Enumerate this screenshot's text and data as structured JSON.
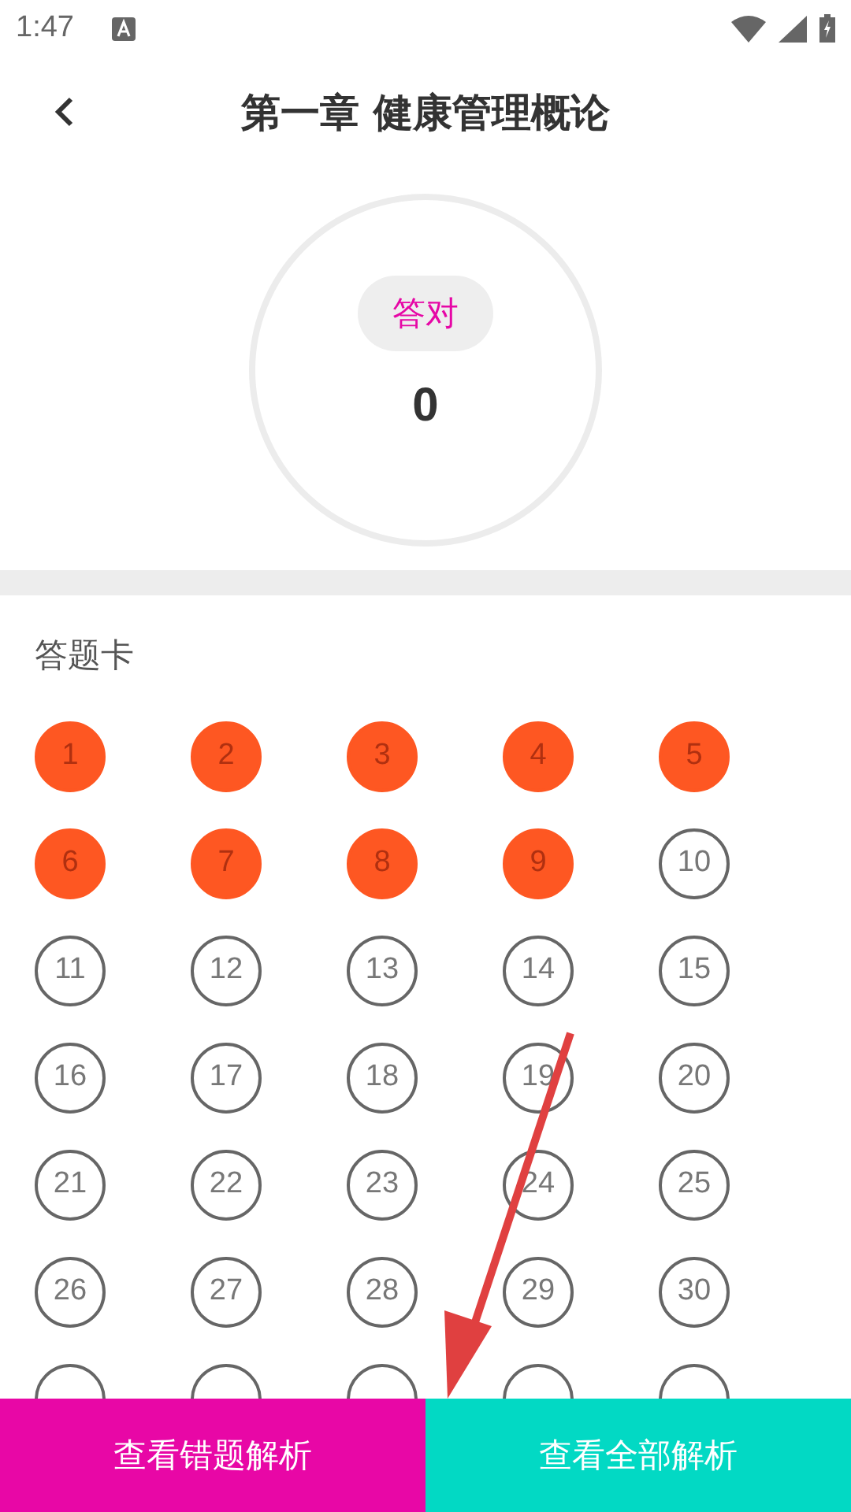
{
  "status_bar": {
    "time": "1:47"
  },
  "header": {
    "title": "第一章 健康管理概论"
  },
  "score": {
    "label": "答对",
    "value": "0"
  },
  "answer_card": {
    "title": "答题卡",
    "items": [
      {
        "label": "1",
        "answered": true
      },
      {
        "label": "2",
        "answered": true
      },
      {
        "label": "3",
        "answered": true
      },
      {
        "label": "4",
        "answered": true
      },
      {
        "label": "5",
        "answered": true
      },
      {
        "label": "6",
        "answered": true
      },
      {
        "label": "7",
        "answered": true
      },
      {
        "label": "8",
        "answered": true
      },
      {
        "label": "9",
        "answered": true
      },
      {
        "label": "10",
        "answered": false
      },
      {
        "label": "11",
        "answered": false
      },
      {
        "label": "12",
        "answered": false
      },
      {
        "label": "13",
        "answered": false
      },
      {
        "label": "14",
        "answered": false
      },
      {
        "label": "15",
        "answered": false
      },
      {
        "label": "16",
        "answered": false
      },
      {
        "label": "17",
        "answered": false
      },
      {
        "label": "18",
        "answered": false
      },
      {
        "label": "19",
        "answered": false
      },
      {
        "label": "20",
        "answered": false
      },
      {
        "label": "21",
        "answered": false
      },
      {
        "label": "22",
        "answered": false
      },
      {
        "label": "23",
        "answered": false
      },
      {
        "label": "24",
        "answered": false
      },
      {
        "label": "25",
        "answered": false
      },
      {
        "label": "26",
        "answered": false
      },
      {
        "label": "27",
        "answered": false
      },
      {
        "label": "28",
        "answered": false
      },
      {
        "label": "29",
        "answered": false
      },
      {
        "label": "30",
        "answered": false
      },
      {
        "answered": false
      },
      {
        "answered": false
      },
      {
        "answered": false
      },
      {
        "answered": false
      },
      {
        "answered": false
      }
    ]
  },
  "buttons": [
    {
      "label": "查看错题解析",
      "kind": "wrong"
    },
    {
      "label": "查看全部解析",
      "kind": "all"
    }
  ]
}
